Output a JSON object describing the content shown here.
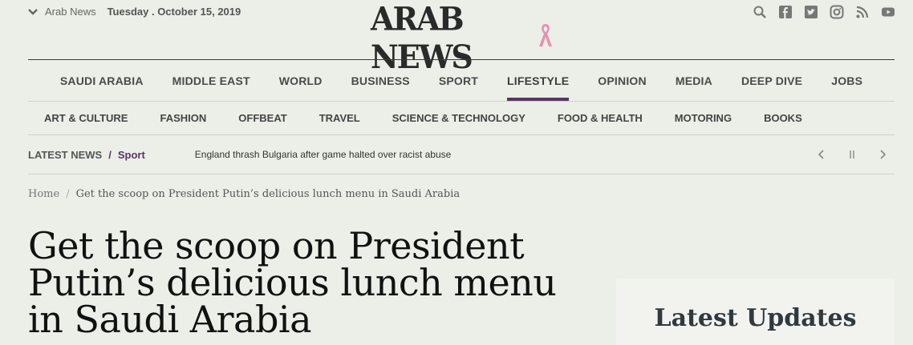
{
  "topbar": {
    "edition": "Arab News",
    "date": "Tuesday . October 15, 2019"
  },
  "logo": {
    "text": "ARAB NEWS"
  },
  "social": [
    "search-icon",
    "facebook-icon",
    "twitter-icon",
    "instagram-icon",
    "rss-icon",
    "youtube-icon"
  ],
  "mainnav": {
    "items": [
      "SAUDI ARABIA",
      "MIDDLE EAST",
      "WORLD",
      "BUSINESS",
      "SPORT",
      "LIFESTYLE",
      "OPINION",
      "MEDIA",
      "DEEP DIVE",
      "JOBS"
    ],
    "active": "LIFESTYLE",
    "accent": "#5b3464"
  },
  "subnav": {
    "items": [
      "ART & CULTURE",
      "FASHION",
      "OFFBEAT",
      "TRAVEL",
      "SCIENCE & TECHNOLOGY",
      "FOOD & HEALTH",
      "MOTORING",
      "BOOKS"
    ]
  },
  "ticker": {
    "label": "LATEST NEWS",
    "slash": "/",
    "category": "Sport",
    "headline": "England thrash Bulgaria after game halted over racist abuse"
  },
  "breadcrumb": {
    "home": "Home",
    "sep": "/",
    "current": "Get the scoop on President Putin’s delicious lunch menu in Saudi Arabia"
  },
  "article": {
    "title": "Get the scoop on President Putin’s delicious lunch menu in Saudi Arabia"
  },
  "sidebar": {
    "title": "Latest Updates"
  }
}
